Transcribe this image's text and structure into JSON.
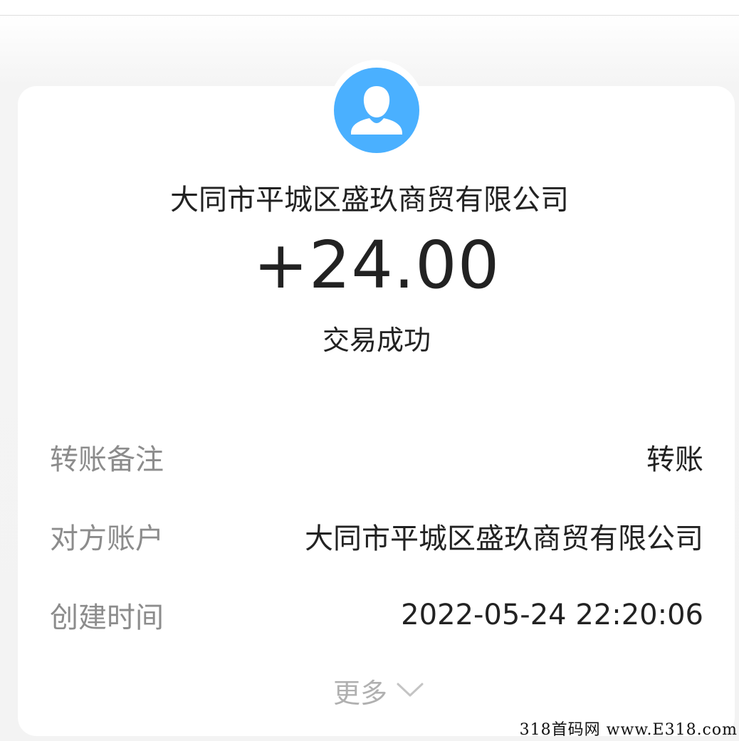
{
  "transaction": {
    "counterparty_name": "大同市平城区盛玖商贸有限公司",
    "amount": "+24.00",
    "status": "交易成功"
  },
  "details": [
    {
      "label": "转账备注",
      "value": "转账"
    },
    {
      "label": "对方账户",
      "value": "大同市平城区盛玖商贸有限公司"
    },
    {
      "label": "创建时间",
      "value": "2022-05-24 22:20:06"
    }
  ],
  "more": {
    "label": "更多",
    "icon": "chevron-down-icon"
  },
  "avatar": {
    "icon": "user-avatar-icon",
    "color": "#4ab0ff"
  },
  "watermark": "318首码网 www.E318.com"
}
